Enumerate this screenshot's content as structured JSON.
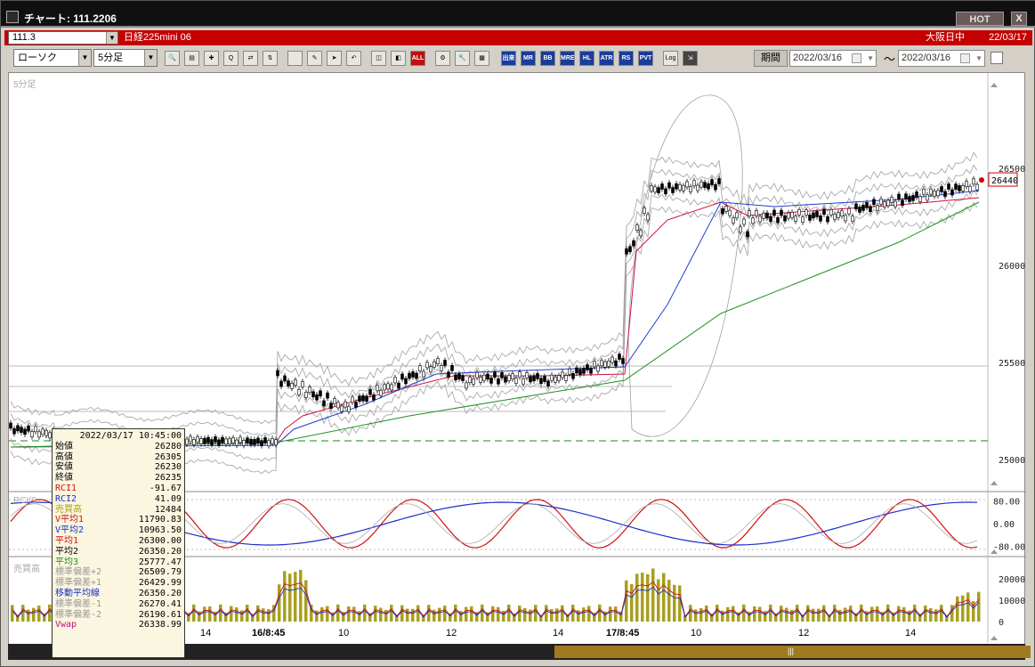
{
  "window": {
    "title": "チャート: 111.2206",
    "hot_label": "HOT",
    "close_label": "X"
  },
  "info": {
    "code": "111.3",
    "instrument": "日経225mini 06",
    "market": "大阪日中",
    "date": "22/03/17"
  },
  "toolbar": {
    "chart_type": "ローソク",
    "interval": "5分足",
    "period_label": "期間",
    "date_from": "2022/03/16",
    "date_separator": "〜",
    "date_to": "2022/03/16",
    "icons": [
      {
        "name": "zoom-icon",
        "text": "🔍"
      },
      {
        "name": "grid-icon",
        "text": "▤"
      },
      {
        "name": "crosshair-icon",
        "text": "✚"
      },
      {
        "name": "search-icon",
        "text": "Q"
      },
      {
        "name": "compare-icon",
        "text": "⇄"
      },
      {
        "name": "range-icon",
        "text": "⇅"
      },
      {
        "name": "blank-icon",
        "text": ""
      },
      {
        "name": "pen-icon",
        "text": "✎"
      },
      {
        "name": "pointer-icon",
        "text": "➤"
      },
      {
        "name": "undo-icon",
        "text": "↶"
      },
      {
        "name": "candle-icon",
        "text": "◫"
      },
      {
        "name": "bar-icon",
        "text": "◧"
      },
      {
        "name": "all-button",
        "text": "ALL"
      },
      {
        "name": "settings-icon",
        "text": "⚙"
      },
      {
        "name": "wrench-icon",
        "text": "🔧"
      },
      {
        "name": "color-icon",
        "text": "▦"
      }
    ],
    "indicators": [
      "出来高",
      "MR",
      "BB",
      "MRE",
      "HL",
      "ATR",
      "RS",
      "PVT"
    ],
    "extra": [
      {
        "name": "log-button",
        "text": "Log"
      },
      {
        "name": "export-icon",
        "text": "⇲"
      }
    ]
  },
  "chart": {
    "pane_label": "5分足",
    "rci_label": "RCI(9,",
    "volume_label": "売買高",
    "last_price": "26440",
    "colors": {
      "rci1": "#d01010",
      "rci2": "#1a2fc8",
      "ma1": "#d01040",
      "ma2": "#2040d0",
      "ma3": "#209020",
      "vol": "#a8a020",
      "bb": "#a0a0a0"
    },
    "price_axis": [
      "26500",
      "26000",
      "25500",
      "25000"
    ],
    "rci_axis": [
      "80.00",
      "0.00",
      "-80.00"
    ],
    "vol_axis": [
      "20000",
      "10000",
      "0"
    ],
    "x_labels": [
      {
        "text": "14",
        "bold": false
      },
      {
        "text": "16/8:45",
        "bold": true
      },
      {
        "text": "10",
        "bold": false
      },
      {
        "text": "12",
        "bold": false
      },
      {
        "text": "14",
        "bold": false
      },
      {
        "text": "17/8:45",
        "bold": true
      },
      {
        "text": "10",
        "bold": false
      },
      {
        "text": "12",
        "bold": false
      },
      {
        "text": "14",
        "bold": false
      }
    ]
  },
  "tooltip": {
    "header": "2022/03/17  10:45:00",
    "rows": [
      {
        "k": "始値",
        "v": "26280",
        "c": "#000"
      },
      {
        "k": "高値",
        "v": "26305",
        "c": "#000"
      },
      {
        "k": "安値",
        "v": "26230",
        "c": "#000"
      },
      {
        "k": "終値",
        "v": "26235",
        "c": "#000"
      },
      {
        "k": "RCI1",
        "v": "-91.67",
        "c": "#d01010"
      },
      {
        "k": "RCI2",
        "v": "41.09",
        "c": "#1a2fc8"
      },
      {
        "k": "売買高",
        "v": "12484",
        "c": "#a8a020"
      },
      {
        "k": "V平均1",
        "v": "11790.83",
        "c": "#d01010"
      },
      {
        "k": "V平均2",
        "v": "10963.50",
        "c": "#1a2fc8"
      },
      {
        "k": "平均1",
        "v": "26300.00",
        "c": "#d01010"
      },
      {
        "k": "平均2",
        "v": "26350.20",
        "c": "#000"
      },
      {
        "k": "平均3",
        "v": "25777.47",
        "c": "#209020"
      },
      {
        "k": "標準偏差+2",
        "v": "26509.79",
        "c": "#999"
      },
      {
        "k": "標準偏差+1",
        "v": "26429.99",
        "c": "#999"
      },
      {
        "k": "移動平均線",
        "v": "26350.20",
        "c": "#1a2fc8"
      },
      {
        "k": "標準偏差-1",
        "v": "26270.41",
        "c": "#999"
      },
      {
        "k": "標準偏差-2",
        "v": "26190.61",
        "c": "#999"
      },
      {
        "k": "Vwap",
        "v": "26338.99",
        "c": "#c01080"
      }
    ]
  },
  "scrollbar": {
    "grip": "|||"
  }
}
